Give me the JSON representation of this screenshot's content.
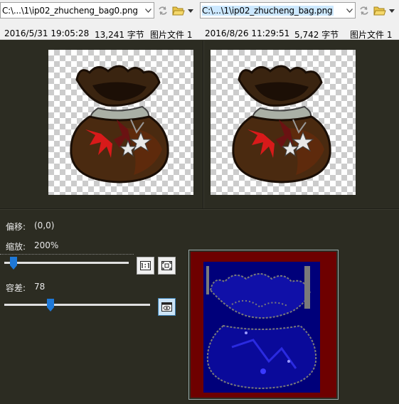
{
  "left": {
    "path": "C:\\...\\1\\ip02_zhucheng_bag0.png",
    "date": "2016/5/31 19:05:28",
    "size": "13,241 字节",
    "type": "图片文件 1"
  },
  "right": {
    "path": "C:\\...\\1\\ip02_zhucheng_bag.png",
    "date": "2016/8/26 11:29:51",
    "size": "5,742 字节",
    "type": "图片文件 1"
  },
  "controls": {
    "offset_label": "偏移:",
    "offset_value": "(0,0)",
    "zoom_label": "缩放:",
    "zoom_value": "200%",
    "zoom_level": 0.05,
    "tolerance_label": "容差:",
    "tolerance_value": "78",
    "tolerance_level": 0.31
  },
  "icons": {
    "sync": "sync-arrow-icon",
    "folder": "folder-open-icon",
    "actual_size": "actual-size-icon",
    "fit": "fit-to-window-icon",
    "eye": "show-differences-icon"
  },
  "colors": {
    "panel_bg": "#2c2c22",
    "toolbar_bg": "#f0f0f0",
    "selection": "#cce8ff",
    "thumb": "#1e78d7",
    "diff_bg": "#6e0000",
    "diff_fg": "#00007a"
  }
}
